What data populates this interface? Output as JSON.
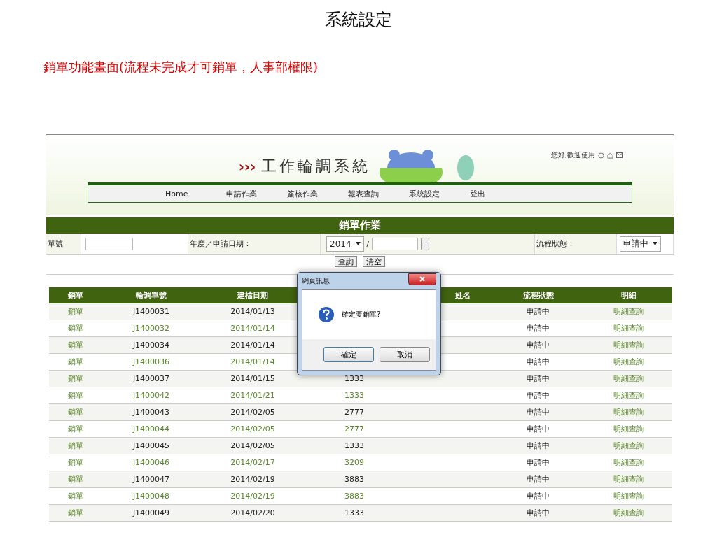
{
  "slide": {
    "title": "系統設定",
    "subtitle": "銷單功能畫面(流程未完成才可銷單，人事部權限)"
  },
  "header": {
    "system_name": "工作輪調系統",
    "arrows": "›››",
    "greeting": "您好,歡迎使用"
  },
  "nav": [
    "Home",
    "申請作業",
    "簽核作業",
    "報表查詢",
    "系統設定",
    "登出"
  ],
  "panel": {
    "title": "銷單作業",
    "order_label": "單號",
    "date_label": "年度／申請日期：",
    "year": "2014",
    "slash": "/",
    "browse": "...",
    "status_label": "流程狀態：",
    "status_value": "申請中",
    "buttons": [
      "查詢",
      "清空"
    ]
  },
  "table": {
    "columns": [
      "銷單",
      "輪調單號",
      "建檔日期",
      "姓名",
      "流程狀態",
      "明細"
    ],
    "rows": [
      {
        "action": "銷單",
        "id": "J1400031",
        "date": "2014/01/13",
        "status": "申請中",
        "detail": "明細查詢"
      },
      {
        "action": "銷單",
        "id": "J1400032",
        "date": "2014/01/14",
        "status": "申請中",
        "detail": "明細查詢"
      },
      {
        "action": "銷單",
        "id": "J1400034",
        "date": "2014/01/14",
        "status": "申請中",
        "detail": "明細查詢"
      },
      {
        "action": "銷單",
        "id": "J1400036",
        "date": "2014/01/14",
        "status": "申請中",
        "detail": "明細查詢"
      },
      {
        "action": "銷單",
        "id": "J1400037",
        "date": "2014/01/15",
        "code": "1333",
        "status": "申請中",
        "detail": "明細查詢"
      },
      {
        "action": "銷單",
        "id": "J1400042",
        "date": "2014/01/21",
        "code": "1333",
        "status": "申請中",
        "detail": "明細查詢"
      },
      {
        "action": "銷單",
        "id": "J1400043",
        "date": "2014/02/05",
        "code": "2777",
        "status": "申請中",
        "detail": "明細查詢"
      },
      {
        "action": "銷單",
        "id": "J1400044",
        "date": "2014/02/05",
        "code": "2777",
        "status": "申請中",
        "detail": "明細查詢"
      },
      {
        "action": "銷單",
        "id": "J1400045",
        "date": "2014/02/05",
        "code": "1333",
        "status": "申請中",
        "detail": "明細查詢"
      },
      {
        "action": "銷單",
        "id": "J1400046",
        "date": "2014/02/17",
        "code": "3209",
        "status": "申請中",
        "detail": "明細查詢"
      },
      {
        "action": "銷單",
        "id": "J1400047",
        "date": "2014/02/19",
        "code": "3883",
        "status": "申請中",
        "detail": "明細查詢"
      },
      {
        "action": "銷單",
        "id": "J1400048",
        "date": "2014/02/19",
        "code": "3883",
        "status": "申請中",
        "detail": "明細查詢"
      },
      {
        "action": "銷單",
        "id": "J1400049",
        "date": "2014/02/20",
        "code": "1333",
        "status": "申請中",
        "detail": "明細查詢"
      }
    ]
  },
  "dialog": {
    "title": "網頁訊息",
    "message": "確定要銷單?",
    "buttons": [
      "確定",
      "取消"
    ]
  }
}
